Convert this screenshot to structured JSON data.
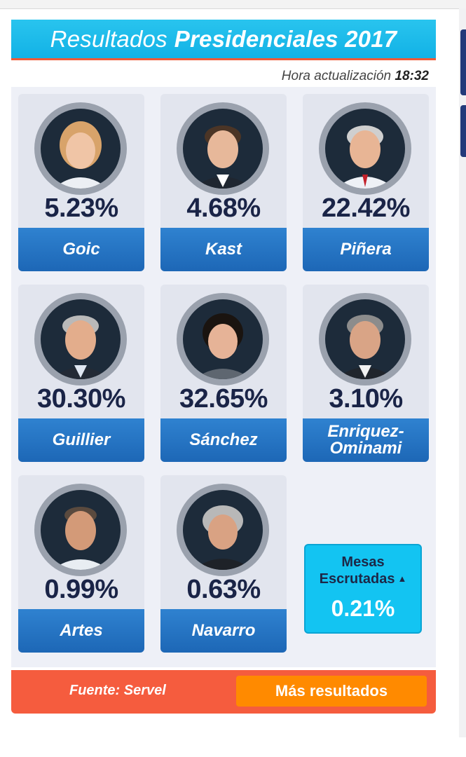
{
  "header": {
    "title_regular": "Resultados",
    "title_bold": "Presidenciales 2017"
  },
  "update": {
    "label": "Hora actualización",
    "time": "18:32"
  },
  "candidates": [
    {
      "pct": "5.23%",
      "name": "Goic"
    },
    {
      "pct": "4.68%",
      "name": "Kast"
    },
    {
      "pct": "22.42%",
      "name": "Piñera"
    },
    {
      "pct": "30.30%",
      "name": "Guillier"
    },
    {
      "pct": "32.65%",
      "name": "Sánchez"
    },
    {
      "pct": "3.10%",
      "name": "Enriquez-Ominami"
    },
    {
      "pct": "0.99%",
      "name": "Artes"
    },
    {
      "pct": "0.63%",
      "name": "Navarro"
    }
  ],
  "mesas": {
    "label_line1": "Mesas",
    "label_line2": "Escrutadas",
    "value": "0.21%"
  },
  "footer": {
    "source": "Fuente: Servel",
    "more_button": "Más resultados"
  },
  "colors": {
    "header": "#12b2e6",
    "accent": "#f05a38",
    "name_bar": "#1d67b6",
    "button": "#ff8a00",
    "mesas": "#13c4f2"
  }
}
